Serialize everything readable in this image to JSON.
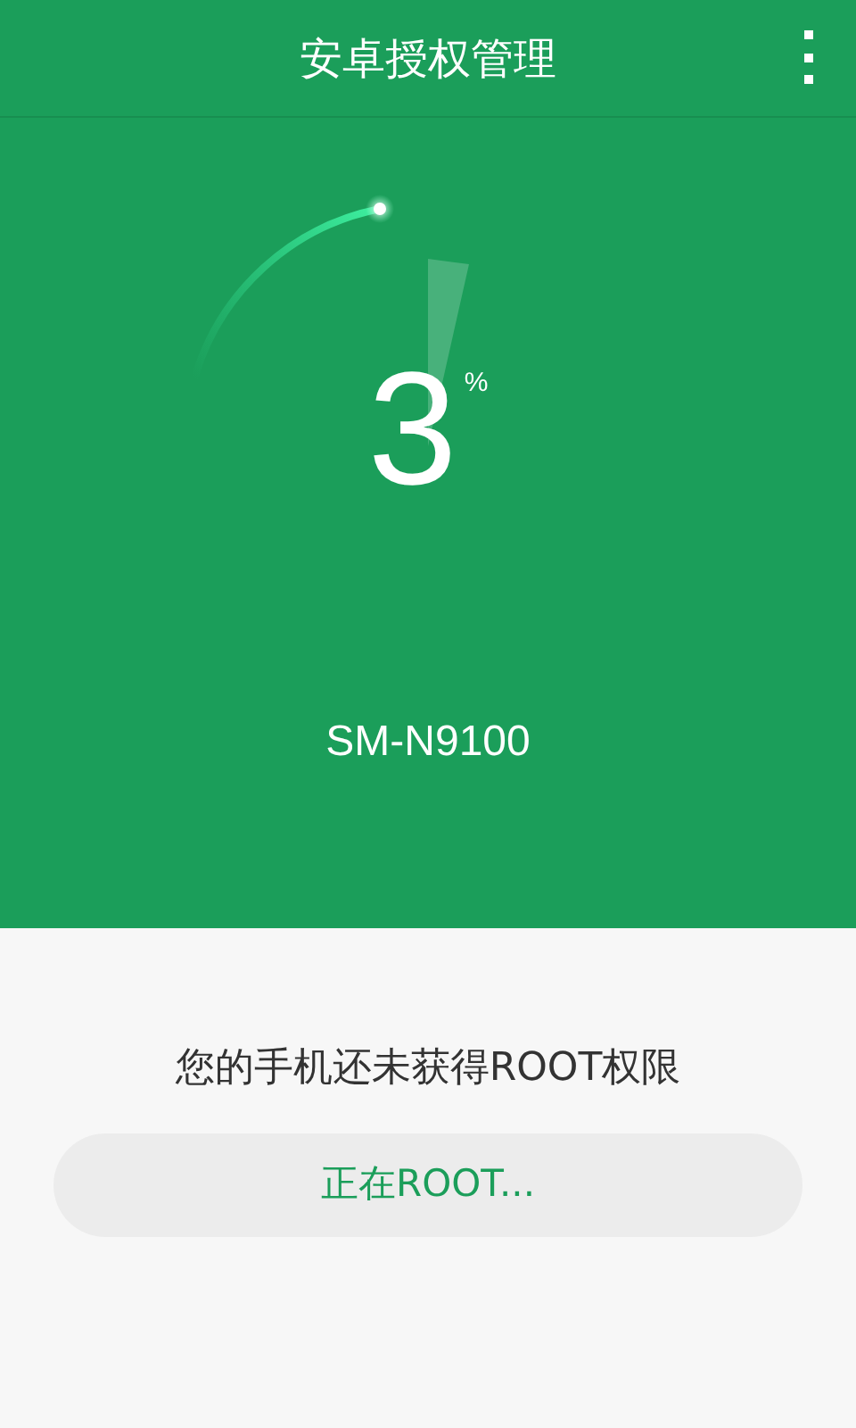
{
  "app_bar": {
    "title": "安卓授权管理"
  },
  "progress": {
    "value": "3",
    "unit": "%"
  },
  "device": {
    "model": "SM-N9100"
  },
  "status": {
    "message": "您的手机还未获得ROOT权限"
  },
  "action_button": {
    "label": "正在ROOT..."
  }
}
